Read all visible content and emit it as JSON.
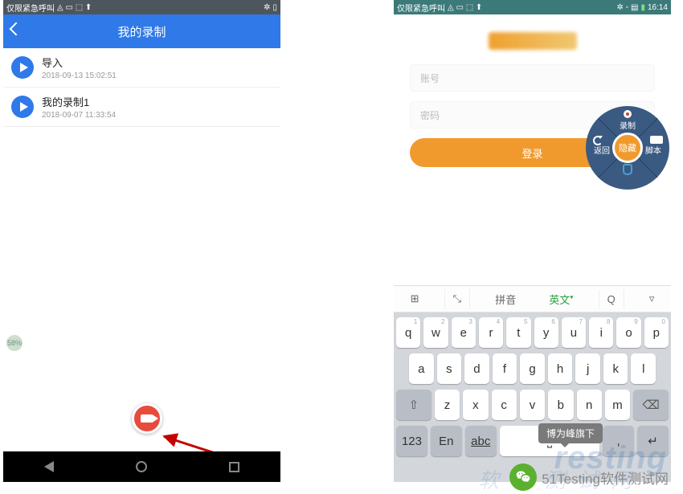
{
  "left": {
    "status_text": "仅限紧急呼叫",
    "title": "我的录制",
    "items": [
      {
        "name": "导入",
        "time": "2018-09-13 15:02:51"
      },
      {
        "name": "我的录制1",
        "time": "2018-09-07 11:33:54"
      }
    ]
  },
  "right": {
    "status_text": "仅限紧急呼叫",
    "time": "16:14",
    "username_ph": "账号",
    "password_ph": "密码",
    "login_label": "登录",
    "radial": {
      "center": "隐藏",
      "top": "录制",
      "right": "脚本",
      "bottom": "",
      "left": "返回"
    },
    "kbd_tabs": [
      "拼音",
      "英文"
    ],
    "rows": {
      "r1": [
        "q",
        "w",
        "e",
        "r",
        "t",
        "y",
        "u",
        "i",
        "o",
        "p"
      ],
      "nums": [
        "1",
        "2",
        "3",
        "4",
        "5",
        "6",
        "7",
        "8",
        "9",
        "0"
      ],
      "r2": [
        "a",
        "s",
        "d",
        "f",
        "g",
        "h",
        "j",
        "k",
        "l"
      ],
      "r3": [
        "z",
        "x",
        "c",
        "v",
        "b",
        "n",
        "m"
      ]
    },
    "shift": "⇧",
    "bksp": "⌫",
    "num_key": "123",
    "lang_key": "En",
    "abc_key": "abc",
    "comma": ",",
    "enter": "↵",
    "prediction": "博为峰旗下"
  },
  "watermark": "51Testing软件测试网",
  "watermark_ghost": "resting",
  "watermark_ghost2": "软 件 测 试 网"
}
